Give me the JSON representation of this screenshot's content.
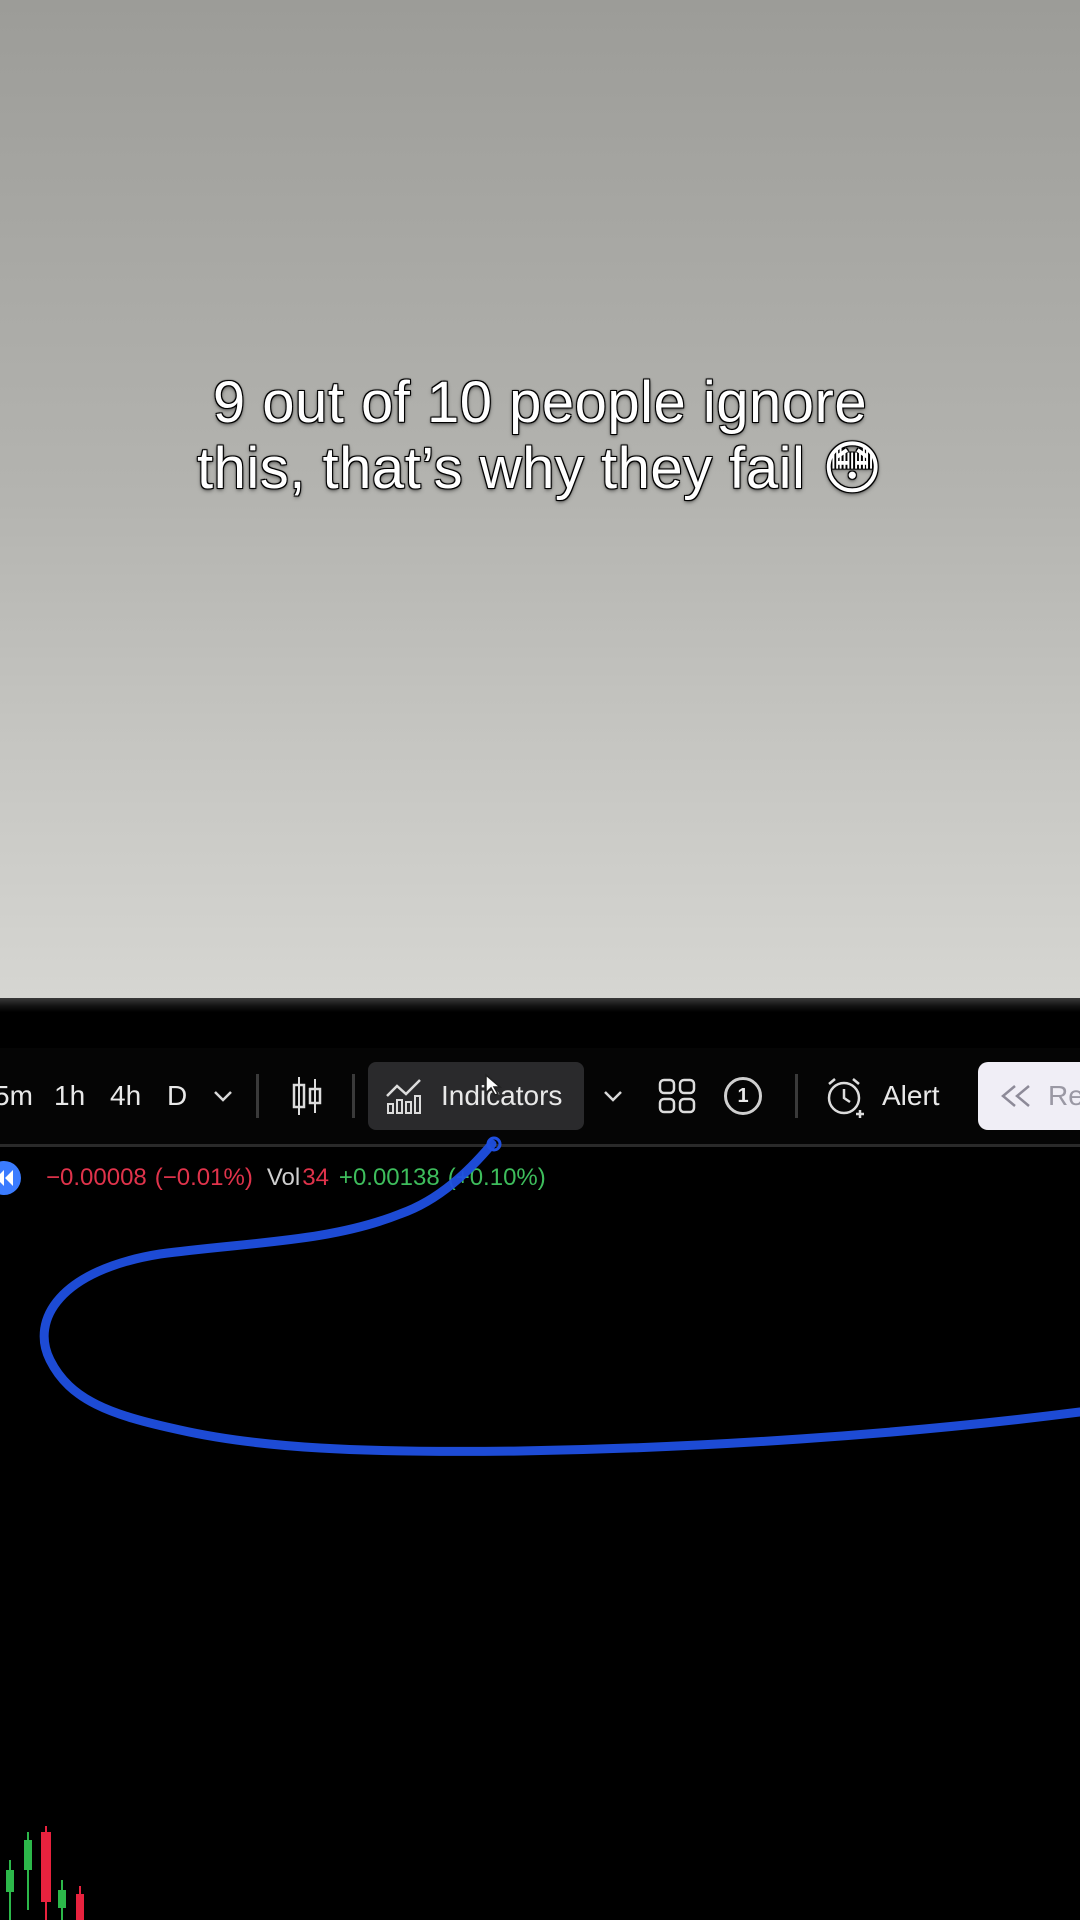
{
  "caption": {
    "line1": "9 out of 10 people ignore",
    "line2": "this, that’s why they fail 😳"
  },
  "toolbar": {
    "timeframes": [
      "5m",
      "1h",
      "4h",
      "D"
    ],
    "indicators_label": "Indicators",
    "layout_count": "1",
    "alert_label": "Alert",
    "replay_label": "Re"
  },
  "legend": {
    "change_value": "−0.00008",
    "change_pct": "(−0.01%)",
    "vol_label": "Vol",
    "vol_value": "34",
    "vol_change": "+0.00138",
    "vol_change_pct": "(+0.10%)"
  },
  "colors": {
    "negative": "#e0334b",
    "positive": "#3ebd5c",
    "annotation_stroke": "#1f4fe0",
    "replay_accent": "#3b7cff"
  },
  "icons": [
    "chevron-down-icon",
    "candles-icon",
    "indicators-icon",
    "layout-grid-icon",
    "alert-clock-icon",
    "rewind-icon",
    "replay-back-icon",
    "cursor-icon"
  ]
}
